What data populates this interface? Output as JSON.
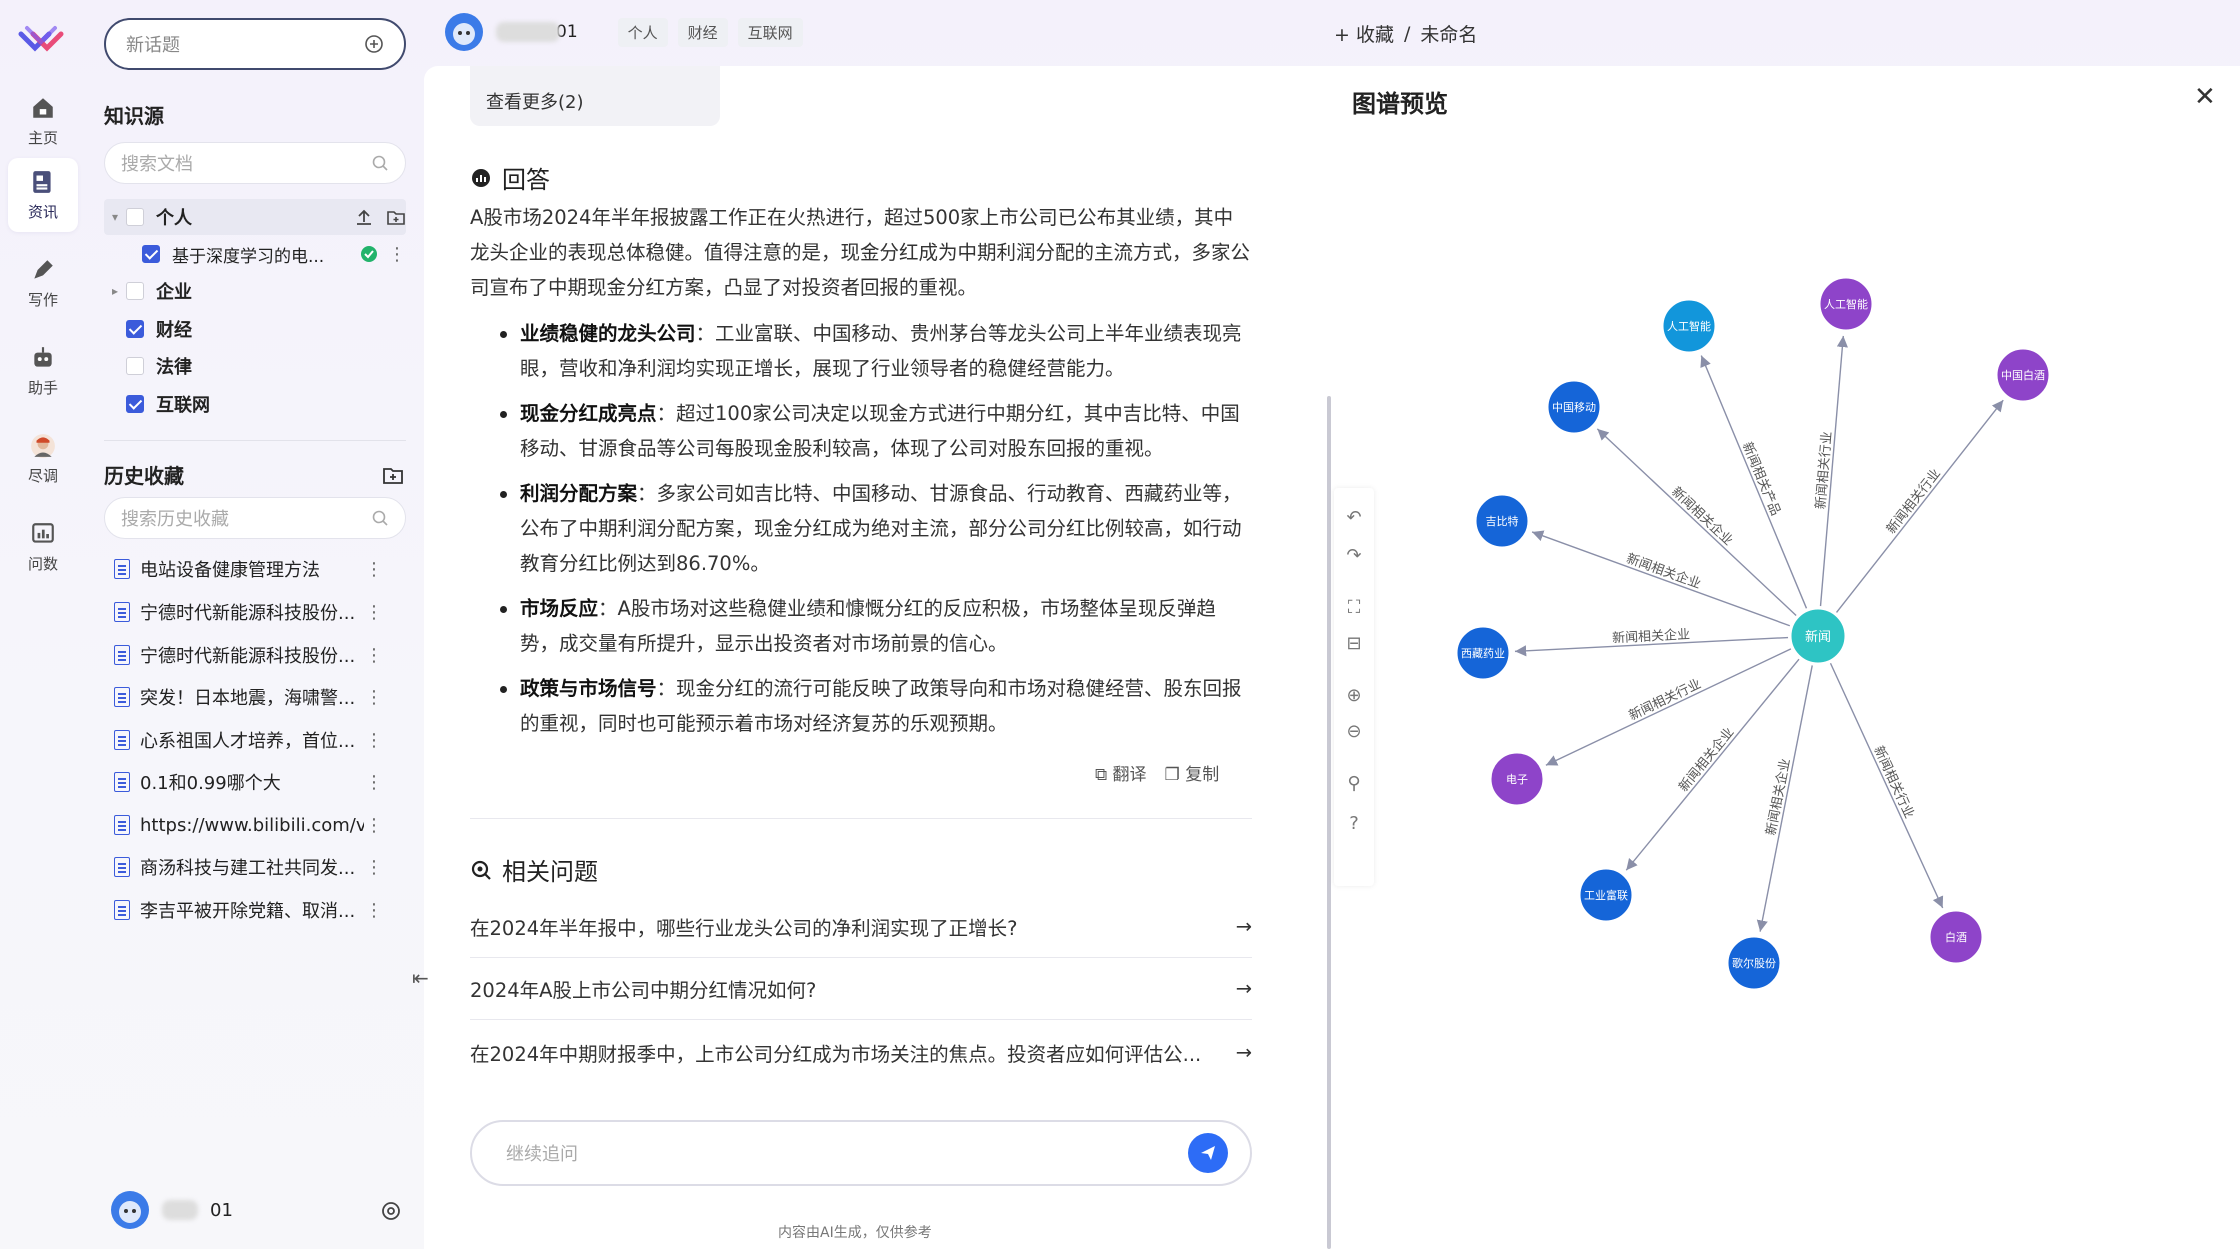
{
  "rail": [
    {
      "label": "主页",
      "icon": "home-icon"
    },
    {
      "label": "资讯",
      "icon": "news-icon",
      "active": true
    },
    {
      "label": "写作",
      "icon": "pen-icon"
    },
    {
      "label": "助手",
      "icon": "robot-icon"
    },
    {
      "label": "尽调",
      "icon": "avatar-icon"
    },
    {
      "label": "问数",
      "icon": "chart-icon"
    }
  ],
  "sidebar": {
    "new_topic": "新话题",
    "knowledge_title": "知识源",
    "search_docs_placeholder": "搜索文档",
    "tree": {
      "personal": "个人",
      "personal_doc": "基于深度学习的电...",
      "enterprise": "企业",
      "finance": "财经",
      "law": "法律",
      "internet": "互联网"
    },
    "history_title": "历史收藏",
    "search_history_placeholder": "搜索历史收藏",
    "history": [
      "电站设备健康管理方法",
      "宁德时代新能源科技股份...",
      "宁德时代新能源科技股份...",
      "突发！日本地震，海啸警...",
      "心系祖国人才培养，首位...",
      "0.1和0.99哪个大",
      "https://www.bilibili.com/v...",
      "商汤科技与建工社共同发...",
      "李吉平被开除党籍、取消..."
    ],
    "user_name": "01"
  },
  "header": {
    "user_name": "01",
    "tags": [
      "个人",
      "财经",
      "互联网"
    ],
    "breadcrumb_add": "+ 收藏",
    "breadcrumb_sep": "/",
    "breadcrumb_name": "未命名"
  },
  "main": {
    "see_more": "查看更多(2)",
    "answer_title": "回答",
    "answer_intro": "A股市场2024年半年报披露工作正在火热进行，超过500家上市公司已公布其业绩，其中龙头企业的表现总体稳健。值得注意的是，现金分红成为中期利润分配的主流方式，多家公司宣布了中期现金分红方案，凸显了对投资者回报的重视。",
    "bullets": [
      {
        "title": "业绩稳健的龙头公司",
        "text": "：工业富联、中国移动、贵州茅台等龙头公司上半年业绩表现亮眼，营收和净利润均实现正增长，展现了行业领导者的稳健经营能力。"
      },
      {
        "title": "现金分红成亮点",
        "text": "：超过100家公司决定以现金方式进行中期分红，其中吉比特、中国移动、甘源食品等公司每股现金股利较高，体现了公司对股东回报的重视。"
      },
      {
        "title": "利润分配方案",
        "text": "：多家公司如吉比特、中国移动、甘源食品、行动教育、西藏药业等，公布了中期利润分配方案，现金分红成为绝对主流，部分公司分红比例较高，如行动教育分红比例达到86.70%。"
      },
      {
        "title": "市场反应",
        "text": "：A股市场对这些稳健业绩和慷慨分红的反应积极，市场整体呈现反弹趋势，成交量有所提升，显示出投资者对市场前景的信心。"
      },
      {
        "title": "政策与市场信号",
        "text": "：现金分红的流行可能反映了政策导向和市场对稳健经营、股东回报的重视，同时也可能预示着市场对经济复苏的乐观预期。"
      }
    ],
    "translate": "翻译",
    "copy": "复制",
    "related_title": "相关问题",
    "related": [
      "在2024年半年报中，哪些行业龙头公司的净利润实现了正增长?",
      "2024年A股上市公司中期分红情况如何?",
      "在2024年中期财报季中，上市公司分红成为市场关注的焦点。投资者应如何评估公..."
    ],
    "ask_placeholder": "继续追问",
    "footer_note": "内容由AI生成，仅供参考"
  },
  "graph": {
    "title": "图谱预览",
    "center": "新闻",
    "nodes": [
      {
        "label": "人工智能",
        "color": "#1296db",
        "edge": "新闻相关产品"
      },
      {
        "label": "人工智能",
        "color": "#8e44c9",
        "edge": "新闻相关行业"
      },
      {
        "label": "中国白酒",
        "color": "#8e44c9",
        "edge": "新闻相关行业"
      },
      {
        "label": "中国移动",
        "color": "#1565d8",
        "edge": "新闻相关企业"
      },
      {
        "label": "吉比特",
        "color": "#1565d8",
        "edge": "新闻相关企业"
      },
      {
        "label": "西藏药业",
        "color": "#1565d8",
        "edge": "新闻相关企业"
      },
      {
        "label": "电子",
        "color": "#8e44c9",
        "edge": "新闻相关行业"
      },
      {
        "label": "工业富联",
        "color": "#1565d8",
        "edge": "新闻相关企业"
      },
      {
        "label": "歌尔股份",
        "color": "#1565d8",
        "edge": "新闻相关企业"
      },
      {
        "label": "白酒",
        "color": "#8e44c9",
        "edge": "新闻相关行业"
      }
    ]
  },
  "colors": {
    "accent": "#2d6cf6",
    "center_node": "#2ec4c4",
    "company": "#1565d8",
    "industry": "#8e44c9",
    "product": "#1296db"
  }
}
